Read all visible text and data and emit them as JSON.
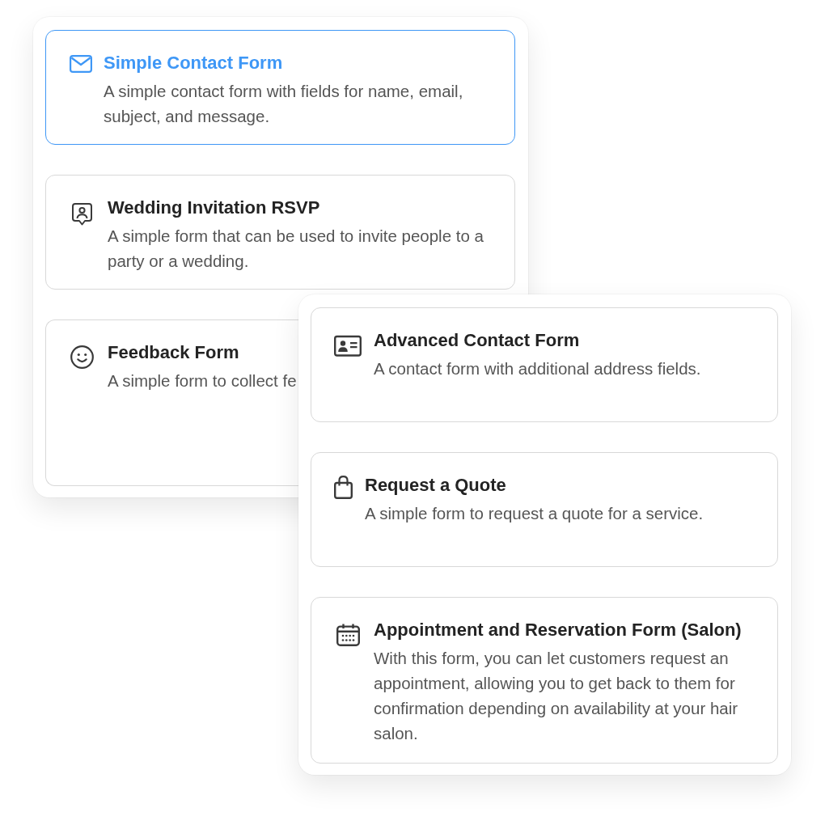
{
  "panels": [
    {
      "templates": [
        {
          "title": "Simple Contact Form",
          "description": "A simple contact form with fields for name, email, subject, and message.",
          "selected": true
        },
        {
          "title": "Wedding Invitation RSVP",
          "description": "A simple form that can be used to invite people to a party or a wedding.",
          "selected": false
        },
        {
          "title": "Feedback Form",
          "description": "A simple form to collect fe",
          "selected": false
        }
      ]
    },
    {
      "templates": [
        {
          "title": "Advanced Contact Form",
          "description": "A contact form with additional address fields.",
          "selected": false
        },
        {
          "title": "Request a Quote",
          "description": "A simple form to request a quote for a service.",
          "selected": false
        },
        {
          "title": "Appointment and Reservation Form (Salon)",
          "description": "With this form, you can let customers request an appointment, allowing you to get back to them for confirmation depending on availability at your hair salon.",
          "selected": false
        }
      ]
    }
  ]
}
